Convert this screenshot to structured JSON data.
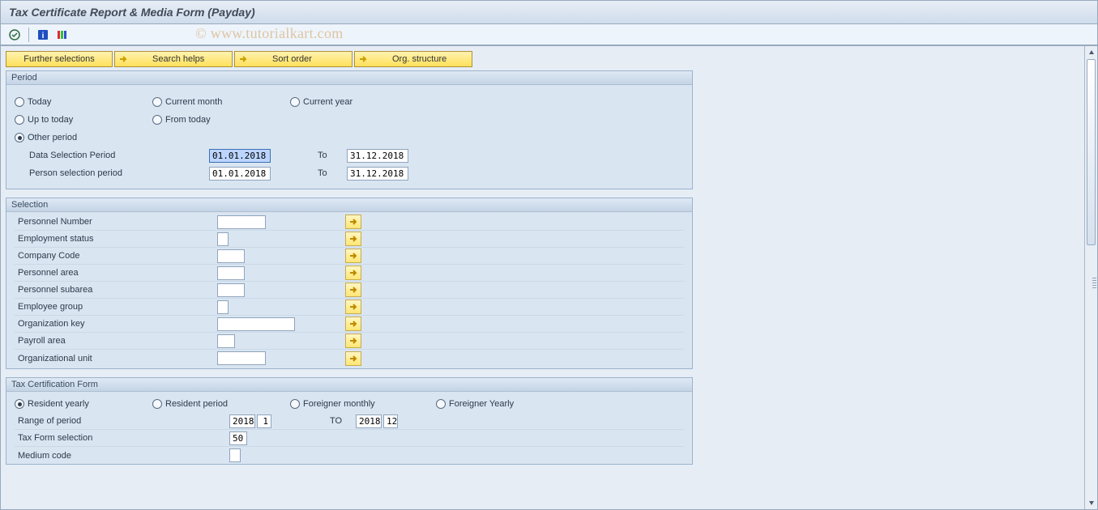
{
  "title": "Tax Certificate Report & Media Form (Payday)",
  "watermark": "© www.tutorialkart.com",
  "buttons": {
    "further_selections": "Further selections",
    "search_helps": "Search helps",
    "sort_order": "Sort order",
    "org_structure": "Org. structure"
  },
  "period": {
    "title": "Period",
    "today": "Today",
    "current_month": "Current month",
    "current_year": "Current year",
    "up_to_today": "Up to today",
    "from_today": "From today",
    "other_period": "Other period",
    "data_sel_label": "Data Selection Period",
    "data_sel_from": "01.01.2018",
    "data_sel_to": "31.12.2018",
    "person_sel_label": "Person selection period",
    "person_sel_from": "01.01.2018",
    "person_sel_to": "31.12.2018",
    "to_label": "To"
  },
  "selection": {
    "title": "Selection",
    "rows": [
      "Personnel Number",
      "Employment status",
      "Company Code",
      "Personnel area",
      "Personnel subarea",
      "Employee group",
      "Organization key",
      "Payroll area",
      "Organizational unit"
    ]
  },
  "tax": {
    "title": "Tax Certification Form",
    "resident_yearly": "Resident yearly",
    "resident_period": "Resident period",
    "foreigner_monthly": "Foreigner monthly",
    "foreigner_yearly": "Foreigner Yearly",
    "range_label": "Range of period",
    "range_from_y": "2018",
    "range_from_m": "1",
    "to_label": "TO",
    "range_to_y": "2018",
    "range_to_m": "12",
    "tax_form_label": "Tax Form selection",
    "tax_form_val": "50",
    "medium_label": "Medium code",
    "medium_val": ""
  }
}
